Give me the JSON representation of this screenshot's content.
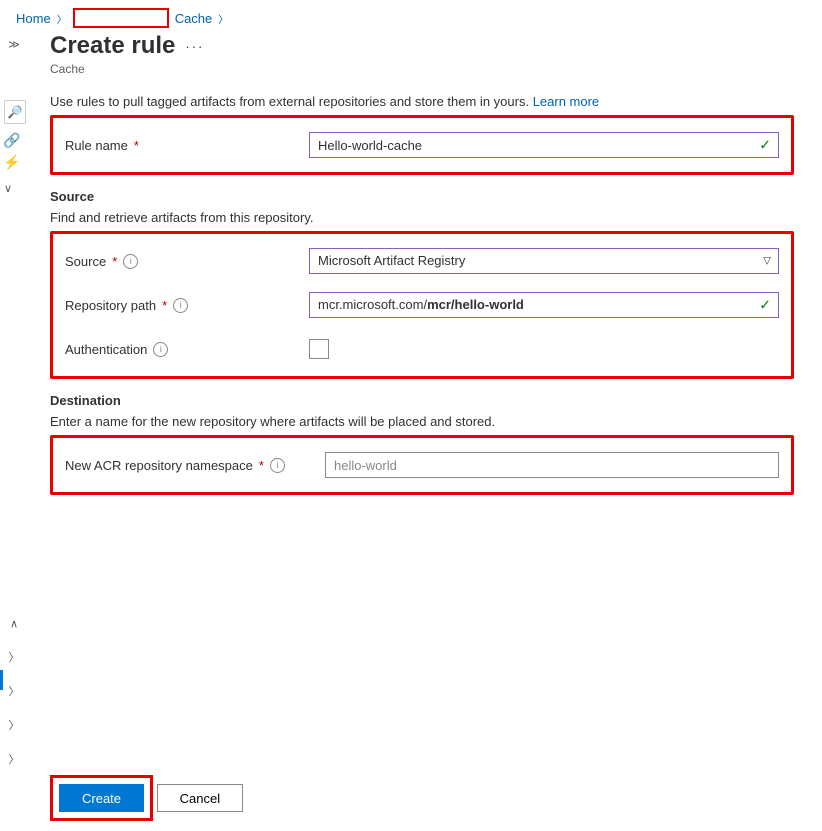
{
  "breadcrumb": {
    "home": "Home",
    "cache": "Cache"
  },
  "header": {
    "title": "Create rule",
    "subtitle": "Cache",
    "more_tooltip": "More"
  },
  "description": {
    "text": "Use rules to pull tagged artifacts from external repositories and store them in yours.",
    "learn_more": "Learn more"
  },
  "rule": {
    "name_label": "Rule name",
    "name_value": "Hello-world-cache"
  },
  "source": {
    "heading": "Source",
    "hint": "Find and retrieve artifacts from this repository.",
    "source_label": "Source",
    "source_value": "Microsoft Artifact Registry",
    "repo_label": "Repository path",
    "repo_prefix": "mcr.microsoft.com/",
    "repo_value": "mcr/hello-world",
    "auth_label": "Authentication"
  },
  "destination": {
    "heading": "Destination",
    "hint": "Enter a name for the new repository where artifacts will be placed and stored.",
    "ns_label": "New ACR repository namespace",
    "ns_value": "hello-world"
  },
  "footer": {
    "create": "Create",
    "cancel": "Cancel"
  }
}
